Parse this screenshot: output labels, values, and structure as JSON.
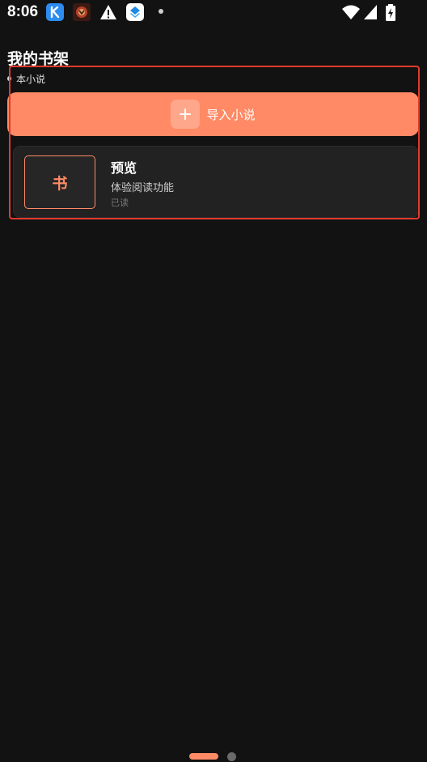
{
  "status_bar": {
    "time": "8:06",
    "notification_icons": [
      "k-app-icon",
      "game-app-icon",
      "warning-icon",
      "layers-app-icon",
      "more-dot-icon"
    ],
    "system_icons": [
      "wifi-icon",
      "signal-icon",
      "battery-charging-icon"
    ]
  },
  "shelf": {
    "title": "我的书架",
    "count_label": "本小说",
    "import_label": "导入小说",
    "books": [
      {
        "cover_char": "书",
        "title": "预览",
        "description": "体验阅读功能",
        "status": "已读"
      }
    ]
  },
  "pager": {
    "page_count": 2,
    "current_page": 1
  },
  "colors": {
    "background": "#121212",
    "accent": "#ff8a65",
    "card": "#222222",
    "highlight": "#e23a2b"
  }
}
